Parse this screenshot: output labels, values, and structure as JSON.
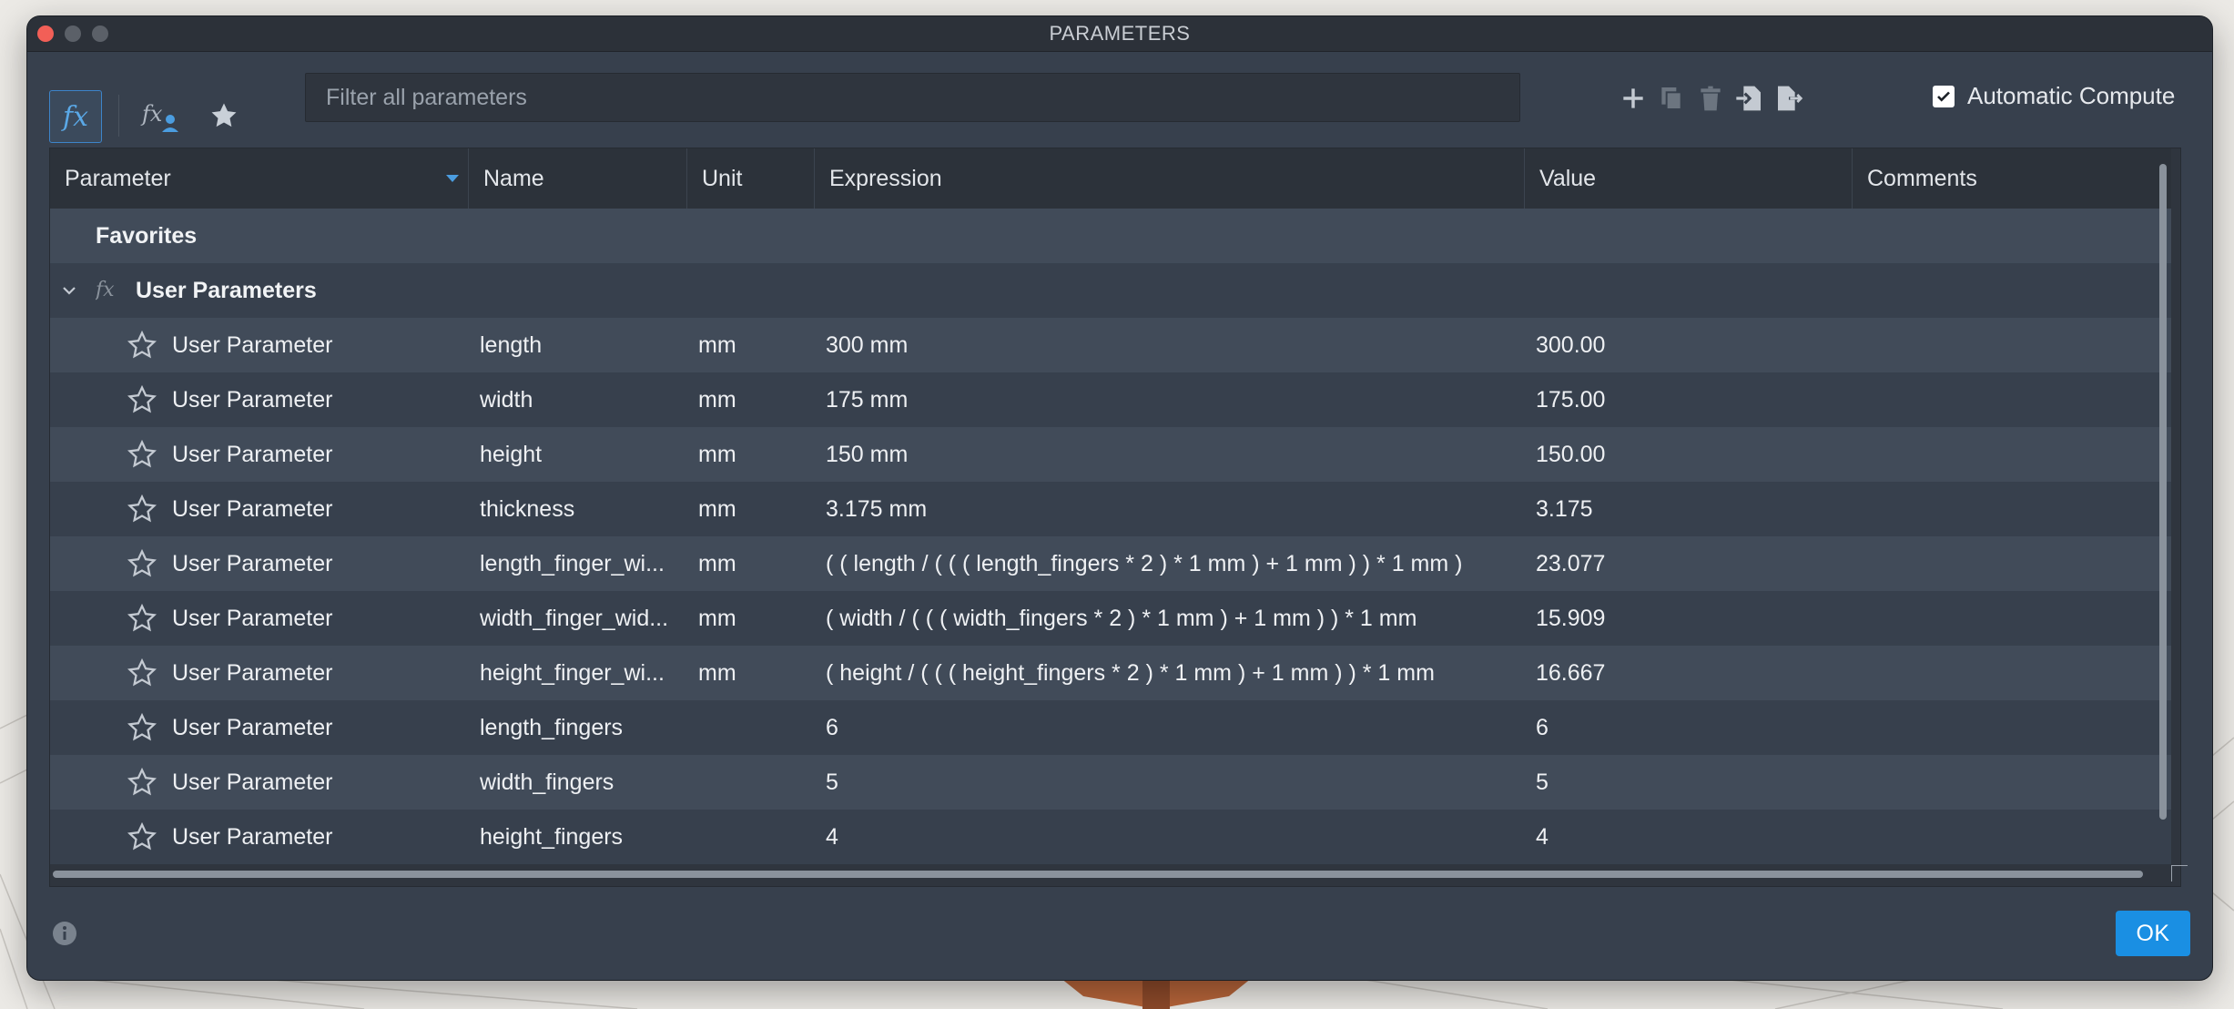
{
  "window": {
    "title": "PARAMETERS"
  },
  "toolbar": {
    "filter_placeholder": "Filter all parameters",
    "fx_label": "fx",
    "auto_compute_label": "Automatic Compute",
    "auto_compute_checked": true
  },
  "table": {
    "columns": [
      "Parameter",
      "Name",
      "Unit",
      "Expression",
      "Value",
      "Comments"
    ],
    "favorites_label": "Favorites",
    "group_label": "User Parameters",
    "rows": [
      {
        "parameter": "User Parameter",
        "name": "length",
        "unit": "mm",
        "expression": "300 mm",
        "value": "300.00",
        "comments": ""
      },
      {
        "parameter": "User Parameter",
        "name": "width",
        "unit": "mm",
        "expression": "175 mm",
        "value": "175.00",
        "comments": ""
      },
      {
        "parameter": "User Parameter",
        "name": "height",
        "unit": "mm",
        "expression": "150 mm",
        "value": "150.00",
        "comments": ""
      },
      {
        "parameter": "User Parameter",
        "name": "thickness",
        "unit": "mm",
        "expression": "3.175 mm",
        "value": "3.175",
        "comments": ""
      },
      {
        "parameter": "User Parameter",
        "name": "length_finger_wi...",
        "unit": "mm",
        "expression": "( ( length / ( ( ( length_fingers * 2 ) * 1 mm ) + 1 mm ) ) * 1 mm )",
        "value": "23.077",
        "comments": ""
      },
      {
        "parameter": "User Parameter",
        "name": "width_finger_wid...",
        "unit": "mm",
        "expression": "( width / ( ( ( width_fingers * 2 ) * 1 mm ) + 1 mm ) ) * 1 mm",
        "value": "15.909",
        "comments": ""
      },
      {
        "parameter": "User Parameter",
        "name": "height_finger_wi...",
        "unit": "mm",
        "expression": "( height / ( ( ( height_fingers * 2 ) * 1 mm ) + 1 mm ) ) * 1 mm",
        "value": "16.667",
        "comments": ""
      },
      {
        "parameter": "User Parameter",
        "name": "length_fingers",
        "unit": "",
        "expression": "6",
        "value": "6",
        "comments": ""
      },
      {
        "parameter": "User Parameter",
        "name": "width_fingers",
        "unit": "",
        "expression": "5",
        "value": "5",
        "comments": ""
      },
      {
        "parameter": "User Parameter",
        "name": "height_fingers",
        "unit": "",
        "expression": "4",
        "value": "4",
        "comments": ""
      }
    ]
  },
  "footer": {
    "ok_label": "OK"
  },
  "colors": {
    "accent": "#1a8fe3",
    "panel": "#37404d",
    "row_alt": "#414b59"
  }
}
